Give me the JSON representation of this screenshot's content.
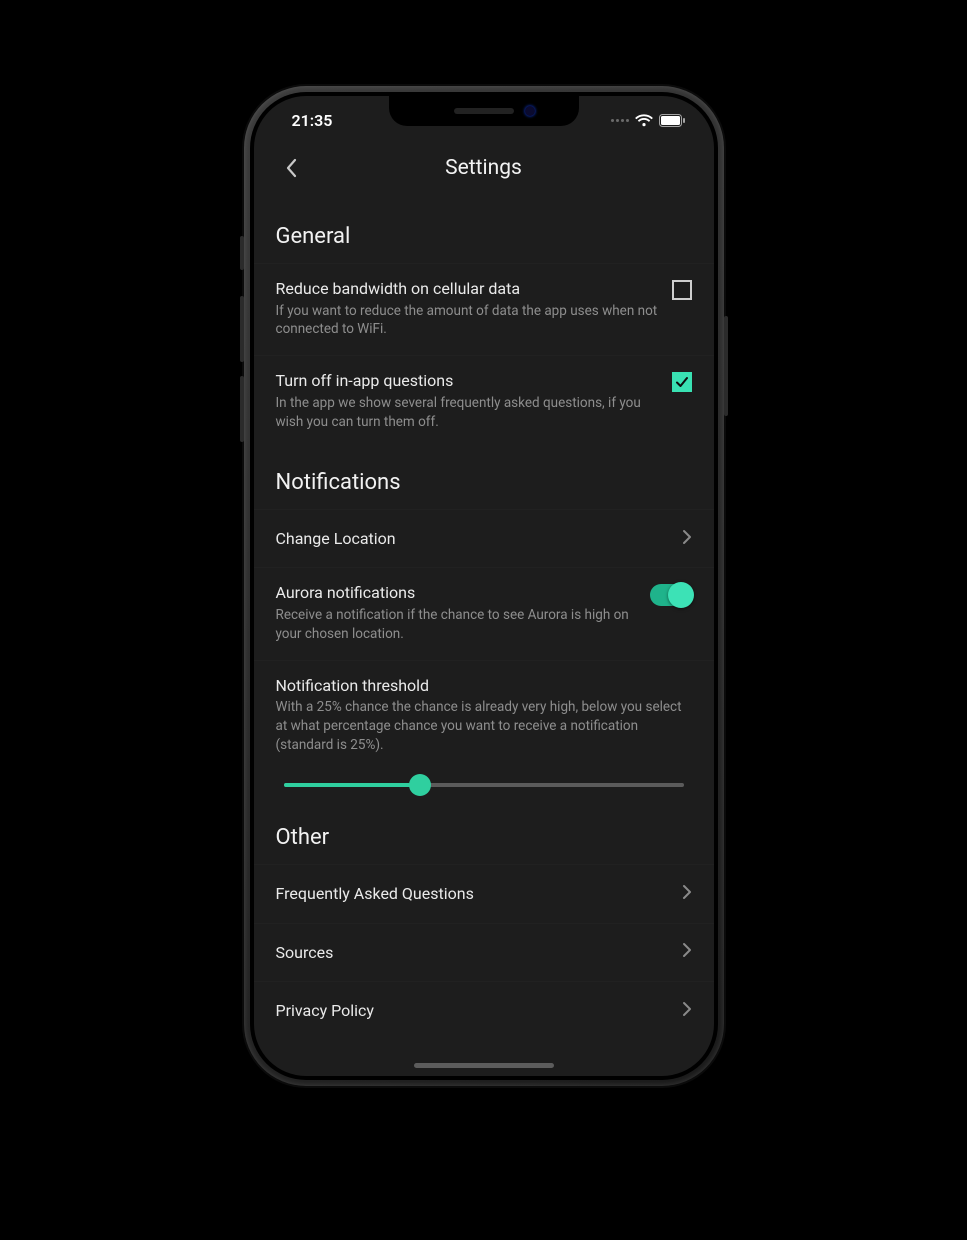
{
  "status": {
    "time": "21:35"
  },
  "header": {
    "title": "Settings"
  },
  "colors": {
    "accent": "#39e2b3"
  },
  "sections": {
    "general": {
      "heading": "General",
      "reduce_bw": {
        "title": "Reduce bandwidth on cellular data",
        "desc": "If you want to reduce the amount of data the app uses when not connected to WiFi.",
        "checked": false
      },
      "turn_off_q": {
        "title": "Turn off in-app questions",
        "desc": "In the app we show several frequently asked questions, if you wish you can turn them off.",
        "checked": true
      }
    },
    "notifications": {
      "heading": "Notifications",
      "change_location": {
        "title": "Change Location"
      },
      "aurora": {
        "title": "Aurora notifications",
        "desc": "Receive a notification if the chance to see Aurora is high on your chosen location.",
        "on": true
      },
      "threshold": {
        "title": "Notification threshold",
        "desc": "With a 25% chance the chance is already very high, below you select at what percentage chance you want to receive a notification (standard is 25%).",
        "value_pct": 34
      }
    },
    "other": {
      "heading": "Other",
      "faq": {
        "title": "Frequently Asked Questions"
      },
      "sources": {
        "title": "Sources"
      },
      "privacy": {
        "title": "Privacy Policy"
      }
    }
  }
}
